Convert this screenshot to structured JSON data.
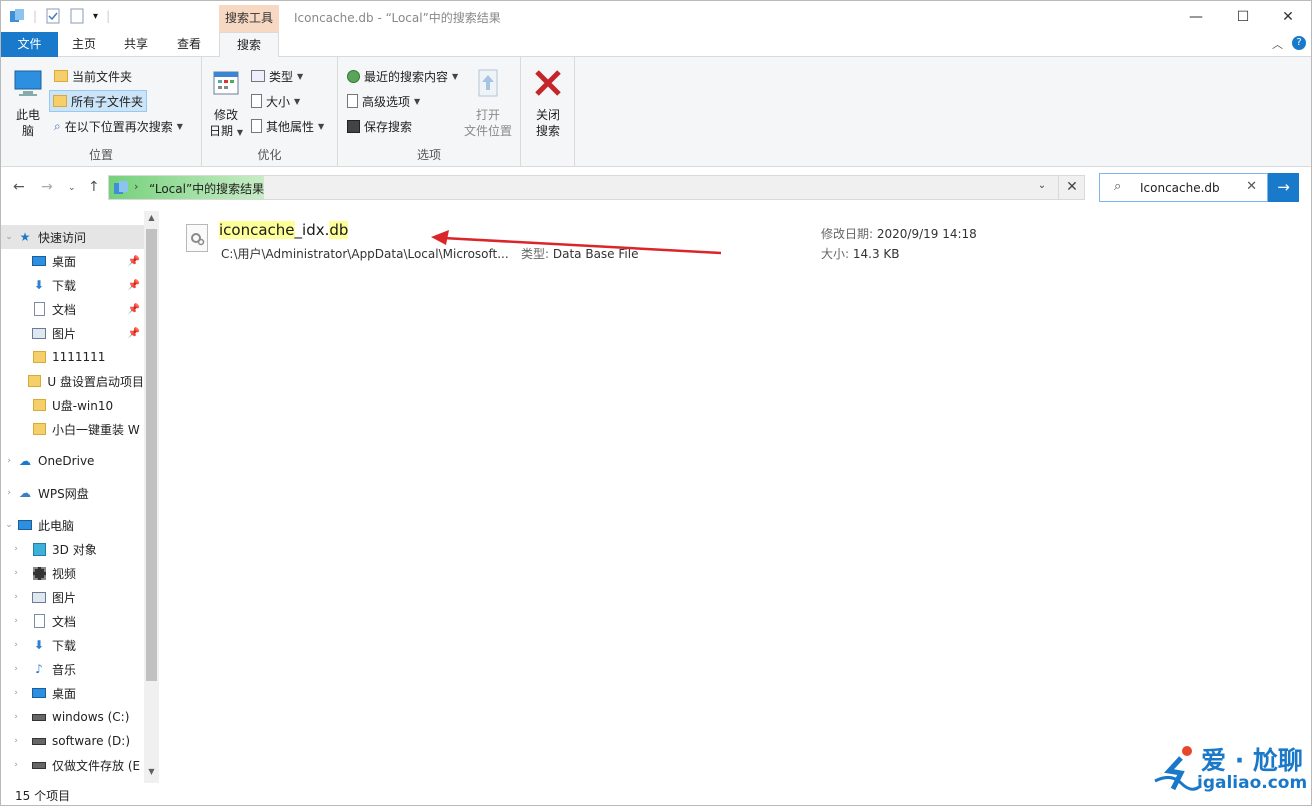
{
  "window": {
    "title": "Iconcache.db - “Local”中的搜索结果",
    "context_tab": "搜索工具"
  },
  "ribbon_tabs": {
    "file": "文件",
    "home": "主页",
    "share": "共享",
    "view": "查看",
    "search": "搜索"
  },
  "ribbon": {
    "location": {
      "this_pc_line1": "此电",
      "this_pc_line2": "脑",
      "current_folder": "当前文件夹",
      "all_subfolders": "所有子文件夹",
      "search_again": "在以下位置再次搜索",
      "label": "位置"
    },
    "refine": {
      "modified_line1": "修改",
      "modified_line2": "日期",
      "type": "类型",
      "size": "大小",
      "other_props": "其他属性",
      "label": "优化"
    },
    "options": {
      "recent_searches": "最近的搜索内容",
      "advanced": "高级选项",
      "save_search": "保存搜索",
      "open_location_line1": "打开",
      "open_location_line2": "文件位置",
      "label": "选项"
    },
    "close": {
      "line1": "关闭",
      "line2": "搜索"
    }
  },
  "address": {
    "path": "“Local”中的搜索结果"
  },
  "search": {
    "query": "Iconcache.db"
  },
  "nav": {
    "quick_access": "快速访问",
    "items": [
      {
        "label": "桌面",
        "icon": "desktop-icon",
        "pinned": true
      },
      {
        "label": "下载",
        "icon": "download-icon",
        "pinned": true
      },
      {
        "label": "文档",
        "icon": "document-icon",
        "pinned": true
      },
      {
        "label": "图片",
        "icon": "picture-icon",
        "pinned": true
      },
      {
        "label": "1111111",
        "icon": "folder-icon",
        "pinned": false
      },
      {
        "label": "U 盘设置启动项目",
        "icon": "folder-icon",
        "pinned": false
      },
      {
        "label": "U盘-win10",
        "icon": "folder-icon",
        "pinned": false
      },
      {
        "label": "小白一键重装 W",
        "icon": "folder-icon",
        "pinned": false
      }
    ],
    "onedrive": "OneDrive",
    "wps": "WPS网盘",
    "this_pc": "此电脑",
    "pc_items": [
      {
        "label": "3D 对象",
        "icon": "3d-objects-icon"
      },
      {
        "label": "视频",
        "icon": "video-icon"
      },
      {
        "label": "图片",
        "icon": "picture-icon"
      },
      {
        "label": "文档",
        "icon": "document-icon"
      },
      {
        "label": "下载",
        "icon": "download-icon"
      },
      {
        "label": "音乐",
        "icon": "music-icon"
      },
      {
        "label": "桌面",
        "icon": "desktop-icon"
      },
      {
        "label": "windows (C:)",
        "icon": "drive-icon"
      },
      {
        "label": "software (D:)",
        "icon": "drive-icon"
      },
      {
        "label": "仅做文件存放 (E",
        "icon": "drive-icon"
      }
    ]
  },
  "result": {
    "name_part1": "iconcache",
    "name_part2": "_idx.",
    "name_part3": "db",
    "path": "C:\\用户\\Administrator\\AppData\\Local\\Microsoft...",
    "type_label": "类型:",
    "type_value": "Data Base File",
    "date_label": "修改日期:",
    "date_value": "2020/9/19 14:18",
    "size_label": "大小:",
    "size_value": "14.3 KB"
  },
  "status": {
    "count": "15 个项目"
  },
  "watermark": {
    "line1": "爱 · 尬聊",
    "line2": "igaliao.com"
  },
  "colors": {
    "accent": "#1979ca",
    "context_tab": "#f7d9c3",
    "highlight": "#ffff9a",
    "arrow": "#d9262b"
  }
}
